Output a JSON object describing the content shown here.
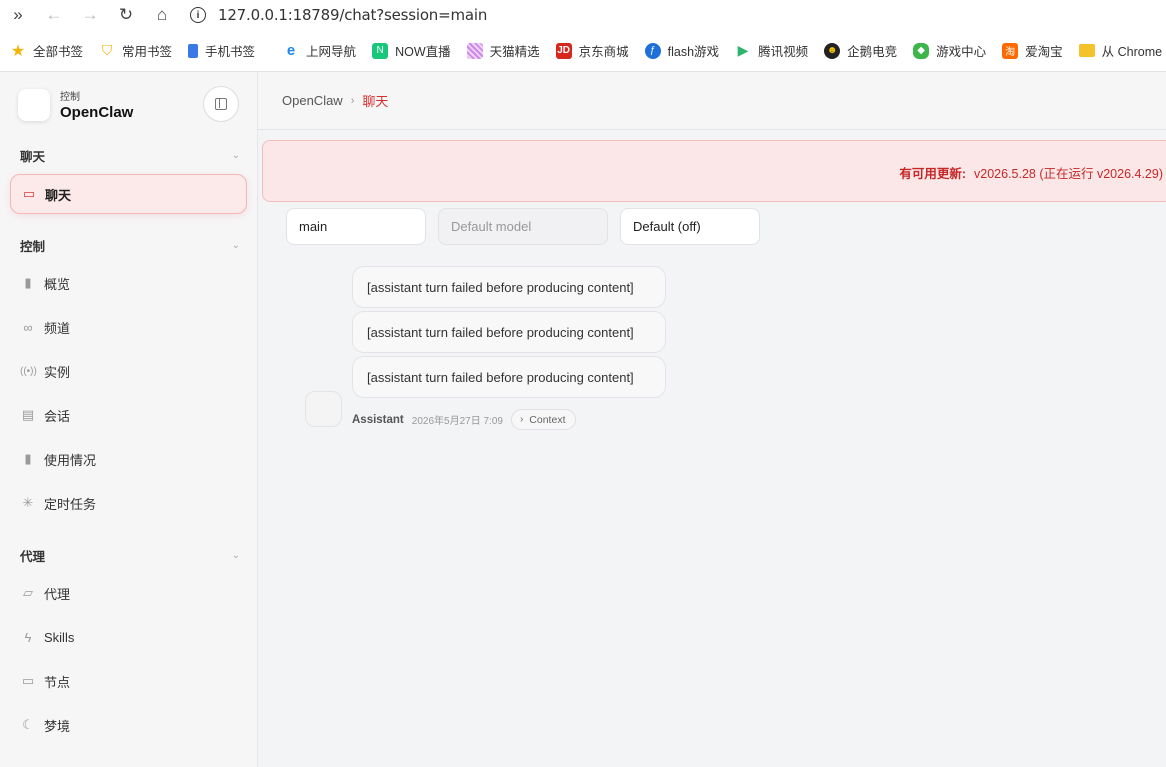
{
  "browser": {
    "url": "127.0.0.1:18789/chat?session=main",
    "bookmarks": [
      {
        "label": "全部书签",
        "icon": "star-icon",
        "color": "#f5b400"
      },
      {
        "label": "常用书签",
        "icon": "bookmark-star-icon",
        "color": "#f5b400"
      },
      {
        "label": "手机书签",
        "icon": "phone-icon",
        "color": "#3b78e7"
      },
      {
        "label": "上网导航",
        "icon": "ie-icon",
        "color": "#1e88e5"
      },
      {
        "label": "NOW直播",
        "icon": "now-live-icon",
        "color": "#18c77c"
      },
      {
        "label": "天猫精选",
        "icon": "tmall-icon",
        "color": "#b06ad6"
      },
      {
        "label": "京东商城",
        "icon": "jd-icon",
        "color": "#d7261c"
      },
      {
        "label": "flash游戏",
        "icon": "flash-icon",
        "color": "#1e6fd9"
      },
      {
        "label": "腾讯视频",
        "icon": "tencent-video-icon",
        "color": "#2fb36c"
      },
      {
        "label": "企鹅电竞",
        "icon": "penguin-esports-icon",
        "color": "#222222"
      },
      {
        "label": "游戏中心",
        "icon": "gamepad-icon",
        "color": "#3cb54a"
      },
      {
        "label": "爱淘宝",
        "icon": "taobao-icon",
        "color": "#ff6a00"
      },
      {
        "label": "从 Chrome 中导",
        "icon": "folder-icon",
        "color": "#f4c22b"
      }
    ]
  },
  "sidebar": {
    "brand_sub": "控制",
    "brand_name": "OpenClaw",
    "groups": {
      "chat": "聊天",
      "control": "控制",
      "agent": "代理"
    },
    "items": {
      "chat": "聊天",
      "overview": "概览",
      "channels": "频道",
      "instances": "实例",
      "sessions": "会话",
      "usage": "使用情况",
      "cron": "定时任务",
      "agents": "代理",
      "skills": "Skills",
      "nodes": "节点",
      "dreams": "梦境"
    }
  },
  "main": {
    "breadcrumb_root": "OpenClaw",
    "breadcrumb_current": "聊天",
    "update_label": "有可用更新:",
    "update_versions": "v2026.5.28 (正在运行 v2026.4.29)",
    "session_value": "main",
    "model_placeholder": "Default model",
    "thinking_value": "Default (off)",
    "messages": [
      "[assistant turn failed before producing content]",
      "[assistant turn failed before producing content]",
      "[assistant turn failed before producing content]"
    ],
    "sender": "Assistant",
    "timestamp": "2026年5月27日 7:09",
    "context_label": "Context"
  },
  "colors": {
    "accent": "#d62f2f",
    "banner_bg": "#fbe7e7",
    "active_bg": "#fce9e9"
  }
}
